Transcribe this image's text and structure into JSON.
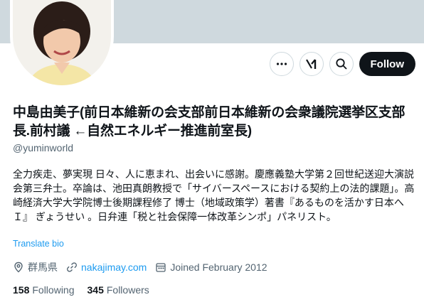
{
  "profile": {
    "display_name": "中島由美子(前日本維新の会支部前日本維新の会衆議院選挙区支部長.前村議 ←自然エネルギー推進前室長)",
    "handle": "@yuminworld",
    "bio": "全力疾走、夢実現 日々、人に恵まれ、出会いに感謝。慶應義塾大学第２回世紀送迎大演説会第三弁士。卒論は、池田真朗教授で「サイバースペースにおける契約上の法的課題」。高崎経済大学大学院博士後期課程修了 博士（地域政策学）著書『あるものを活かす日本へＩ』 ぎょうせい 。日弁連「税と社会保障一体改革シンポ」パネリスト。",
    "translate_label": "Translate bio",
    "location": "群馬県",
    "website": "nakajimay.com",
    "joined": "Joined February 2012",
    "following_count": "158",
    "following_label": "Following",
    "followers_count": "345",
    "followers_label": "Followers"
  },
  "actions": {
    "follow_label": "Follow",
    "more_icon": "more-horizontal-icon",
    "grok_icon": "grok-icon",
    "search_icon": "search-icon"
  },
  "colors": {
    "accent": "#1d9bf0",
    "text": "#0f1419",
    "secondary": "#536471",
    "banner": "#cfd9de"
  }
}
